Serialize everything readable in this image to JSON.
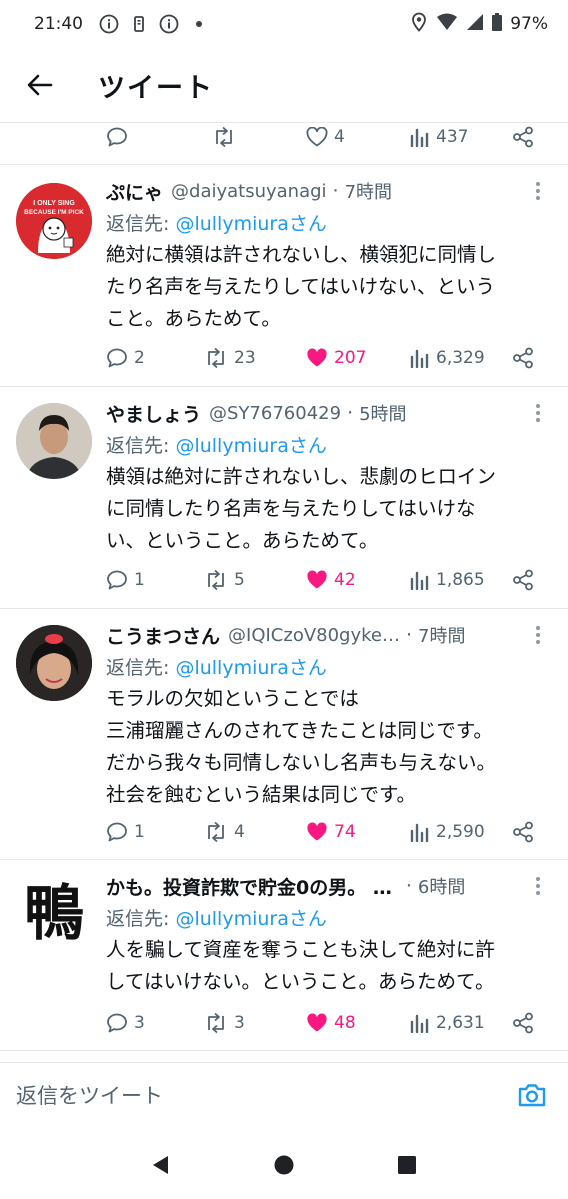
{
  "status_bar": {
    "time": "21:40",
    "battery": "97%"
  },
  "header": {
    "title": "ツイート"
  },
  "top_actions": {
    "likes": "4",
    "views": "437"
  },
  "tweets": [
    {
      "name": "ぷにゃ",
      "handle": "@daiyatsuyanagi",
      "time": "7時間",
      "reply_prefix": "返信先: ",
      "reply_to": "@lullymiuraさん",
      "text": "絶対に横領は許されないし、横領犯に同情し\nたり名声を与えたりしてはいけない、という\nこと。あらためて。",
      "replies": "2",
      "retweets": "23",
      "likes": "207",
      "views": "6,329",
      "avatar_text": "I ONLY SING BECAUSE I'M PICK"
    },
    {
      "name": "やましょう",
      "handle": "@SY76760429",
      "time": "5時間",
      "reply_prefix": "返信先: ",
      "reply_to": "@lullymiuraさん",
      "text": "横領は絶対に許されないし、悲劇のヒロイン\nに同情したり名声を与えたりしてはいけな\nい、ということ。あらためて。",
      "replies": "1",
      "retweets": "5",
      "likes": "42",
      "views": "1,865"
    },
    {
      "name": "こうまつさん",
      "handle": "@IQICzoV80gyke…",
      "time": "7時間",
      "reply_prefix": "返信先: ",
      "reply_to": "@lullymiuraさん",
      "text": "モラルの欠如ということでは\n三浦瑠麗さんのされてきたことは同じです。\nだから我々も同情しないし名声も与えない。\n社会を蝕むという結果は同じです。",
      "replies": "1",
      "retweets": "4",
      "likes": "74",
      "views": "2,590"
    },
    {
      "name": "かも。投資詐欺で貯金0の男。 …",
      "handle": "",
      "time": "6時間",
      "reply_prefix": "返信先: ",
      "reply_to": "@lullymiuraさん",
      "text": "人を騙して資産を奪うことも決して絶対に許\nしてはいけない。ということ。あらためて。",
      "replies": "3",
      "retweets": "3",
      "likes": "48",
      "views": "2,631",
      "avatar_text": "鴨"
    }
  ],
  "reply_bar": {
    "placeholder": "返信をツイート"
  },
  "colors": {
    "like": "#f91880",
    "link": "#1d9bf0",
    "secondary": "#536471"
  },
  "icons": [
    "back-arrow-icon",
    "reply-icon",
    "retweet-icon",
    "heart-icon",
    "views-icon",
    "share-icon",
    "more-icon",
    "camera-icon"
  ]
}
